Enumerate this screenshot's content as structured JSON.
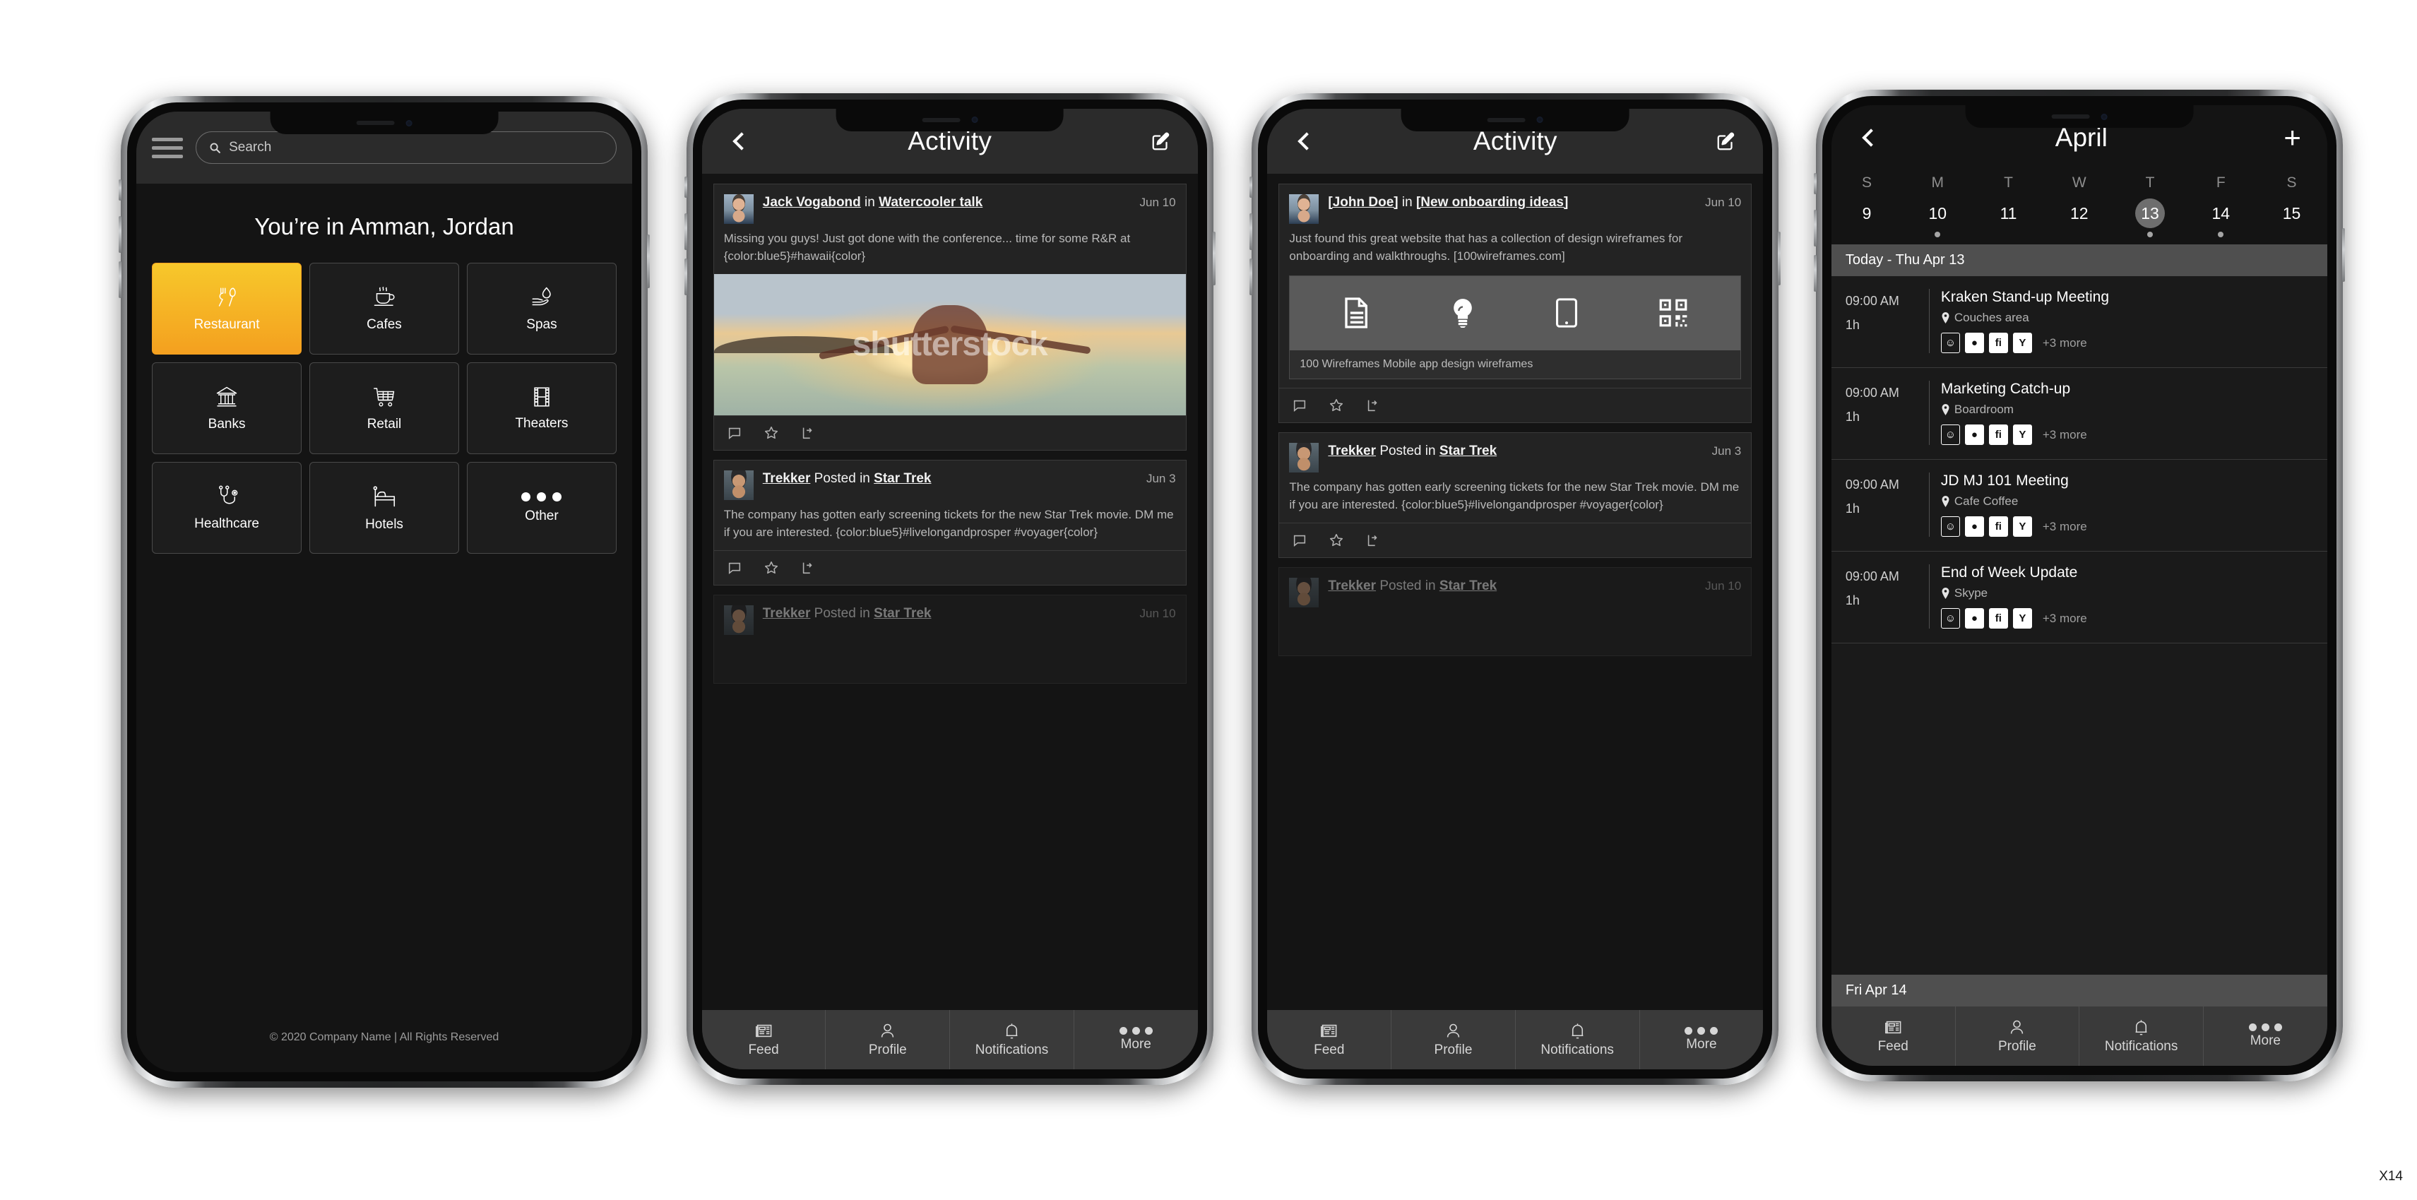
{
  "corner_label": "X14",
  "phone1": {
    "search": {
      "placeholder": "Search",
      "icon": "search-icon"
    },
    "menu_icon": "hamburger-menu-icon",
    "heading": "You’re in Amman, Jordan",
    "categories": [
      {
        "label": "Restaurant",
        "icon": "fork-spoon-icon",
        "active": true
      },
      {
        "label": "Cafes",
        "icon": "coffee-cup-icon",
        "active": false
      },
      {
        "label": "Spas",
        "icon": "water-drop-hand-icon",
        "active": false
      },
      {
        "label": "Banks",
        "icon": "bank-building-icon",
        "active": false
      },
      {
        "label": "Retail",
        "icon": "shopping-cart-icon",
        "active": false
      },
      {
        "label": "Theaters",
        "icon": "film-strip-icon",
        "active": false
      },
      {
        "label": "Healthcare",
        "icon": "stethoscope-icon",
        "active": false
      },
      {
        "label": "Hotels",
        "icon": "bed-icon",
        "active": false
      },
      {
        "label": "Other",
        "icon": "ellipsis-icon",
        "active": false
      }
    ],
    "footer": "© 2020 Company Name | All Rights Reserved",
    "accent_color": "#f4a01f"
  },
  "phone2": {
    "appbar": {
      "title": "Activity",
      "back_icon": "chevron-left-icon",
      "compose_icon": "compose-edit-icon"
    },
    "posts": [
      {
        "author": "Jack Vogabond",
        "connector": "in",
        "channel": "Watercooler talk",
        "date": "Jun 10",
        "body": "Missing you guys! Just got done with the conference... time for some R&R at {color:blue5}#hawaii{color}",
        "image_watermark": "shutterstock",
        "has_image": true
      },
      {
        "author": "Trekker",
        "connector": "Posted in",
        "channel": "Star Trek",
        "date": "Jun 3",
        "body": "The company has gotten early screening tickets for the new Star Trek movie. DM me if you are interested. {color:blue5}#livelongandprosper #voyager{color}",
        "has_image": false
      },
      {
        "author": "Trekker",
        "connector": "Posted in",
        "channel": "Star Trek",
        "date": "Jun 10",
        "body": "",
        "has_image": false
      }
    ],
    "actions": [
      "comment-icon",
      "star-icon",
      "share-icon"
    ],
    "tabs": [
      {
        "label": "Feed",
        "icon": "newspaper-icon"
      },
      {
        "label": "Profile",
        "icon": "person-icon"
      },
      {
        "label": "Notifications",
        "icon": "bell-icon"
      },
      {
        "label": "More",
        "icon": "ellipsis-icon"
      }
    ]
  },
  "phone3": {
    "appbar": {
      "title": "Activity",
      "back_icon": "chevron-left-icon",
      "compose_icon": "compose-edit-icon"
    },
    "posts": [
      {
        "author": "[John Doe]",
        "connector": "in",
        "channel": "[New onboarding ideas]",
        "date": "Jun 10",
        "body": "Just found this great website that has a collection of design wireframes for onboarding and walkthroughs. [100wireframes.com]",
        "link_card": {
          "caption": "100 Wireframes Mobile app design wireframes",
          "icons": [
            "document-icon",
            "lightbulb-icon",
            "tablet-icon",
            "qr-code-icon"
          ]
        }
      },
      {
        "author": "Trekker",
        "connector": "Posted in",
        "channel": "Star Trek",
        "date": "Jun 3",
        "body": "The company has gotten early screening tickets for the new Star Trek movie. DM me if you are interested. {color:blue5}#livelongandprosper #voyager{color}"
      },
      {
        "author": "Trekker",
        "connector": "Posted in",
        "channel": "Star Trek",
        "date": "Jun 10",
        "body": ""
      }
    ],
    "actions": [
      "comment-icon",
      "star-icon",
      "share-icon"
    ],
    "tabs": [
      {
        "label": "Feed",
        "icon": "newspaper-icon"
      },
      {
        "label": "Profile",
        "icon": "person-icon"
      },
      {
        "label": "Notifications",
        "icon": "bell-icon"
      },
      {
        "label": "More",
        "icon": "ellipsis-icon"
      }
    ]
  },
  "phone4": {
    "appbar": {
      "title": "April",
      "back_icon": "chevron-left-icon",
      "add_icon": "plus-icon"
    },
    "weekday_labels": [
      "S",
      "M",
      "T",
      "W",
      "T",
      "F",
      "S"
    ],
    "dates": [
      {
        "num": "9",
        "selected": false,
        "dot": false
      },
      {
        "num": "10",
        "selected": false,
        "dot": true
      },
      {
        "num": "11",
        "selected": false,
        "dot": false
      },
      {
        "num": "12",
        "selected": false,
        "dot": false
      },
      {
        "num": "13",
        "selected": true,
        "dot": true
      },
      {
        "num": "14",
        "selected": false,
        "dot": true
      },
      {
        "num": "15",
        "selected": false,
        "dot": false
      }
    ],
    "section_today": "Today - Thu Apr 13",
    "section_next": "Fri Apr 14",
    "events": [
      {
        "time": "09:00 AM",
        "duration": "1h",
        "title": "Kraken Stand-up Meeting",
        "location": "Couches area",
        "more": "+3 more"
      },
      {
        "time": "09:00 AM",
        "duration": "1h",
        "title": "Marketing Catch-up",
        "location": "Boardroom",
        "more": "+3 more"
      },
      {
        "time": "09:00 AM",
        "duration": "1h",
        "title": "JD MJ 101 Meeting",
        "location": "Cafe Coffee",
        "more": "+3 more"
      },
      {
        "time": "09:00 AM",
        "duration": "1h",
        "title": "End of Week Update",
        "location": "Skype",
        "more": "+3 more"
      }
    ],
    "attendee_glyphs": [
      "☺",
      "●",
      "fi",
      "Y"
    ],
    "tabs": [
      {
        "label": "Feed",
        "icon": "newspaper-icon"
      },
      {
        "label": "Profile",
        "icon": "person-icon"
      },
      {
        "label": "Notifications",
        "icon": "bell-icon"
      },
      {
        "label": "More",
        "icon": "ellipsis-icon"
      }
    ]
  }
}
